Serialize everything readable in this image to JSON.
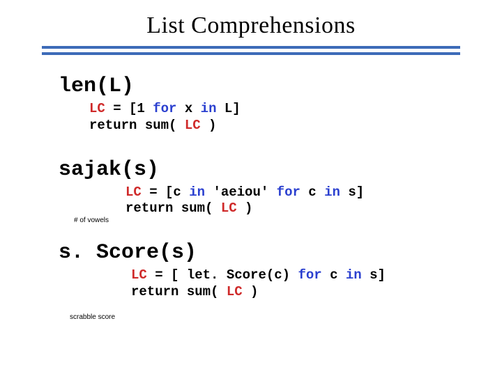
{
  "title": "List Comprehensions",
  "blocks": {
    "len": {
      "name": "len(L)",
      "line1_lc": "LC",
      "line1_eq": " = [1 ",
      "line1_for": "for",
      "line1_mid": " x ",
      "line1_in": "in",
      "line1_end": " L]",
      "line2_a": "return sum( ",
      "line2_lc": "LC",
      "line2_b": " )"
    },
    "sajak": {
      "name": "sajak(s)",
      "note": "# of vowels",
      "line1_lc": "LC",
      "line1_eq": " = [c ",
      "line1_in1": "in",
      "line1_mid": " 'aeiou' ",
      "line1_for": "for",
      "line1_mid2": " c ",
      "line1_in2": "in",
      "line1_end": " s]",
      "line2_a": "return sum( ",
      "line2_lc": "LC",
      "line2_b": " )"
    },
    "sscore": {
      "name": "s. Score(s)",
      "note": "scrabble score",
      "line1_lc": "LC",
      "line1_eq": " = [ let. Score(c) ",
      "line1_for": "for",
      "line1_mid": " c ",
      "line1_in": "in",
      "line1_end": " s]",
      "line2_a": "return sum( ",
      "line2_lc": "LC",
      "line2_b": " )"
    }
  }
}
